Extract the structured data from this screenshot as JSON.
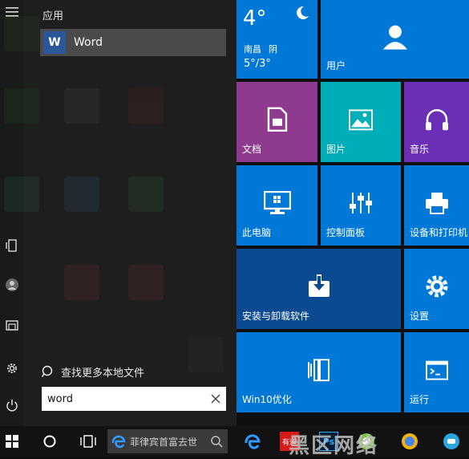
{
  "results": {
    "section_label": "应用",
    "top_result": {
      "icon_text": "W",
      "label": "Word"
    },
    "find_more": "查找更多本地文件",
    "search_value": "word"
  },
  "tiles": {
    "weather": {
      "temp": "4°",
      "city": "南昌",
      "condition": "阴",
      "range": "5°/3°"
    },
    "user": "用户",
    "documents": "文档",
    "pictures": "图片",
    "music": "音乐",
    "this_pc": "此电脑",
    "control_panel": "控制面板",
    "devices_printers": "设备和打印机",
    "install_uninstall": "安装与卸载软件",
    "settings": "设置",
    "win10_optimize": "Win10优化",
    "run": "运行"
  },
  "taskbar": {
    "search_text": "菲律宾首富去世",
    "badge_label": "有道",
    "watermark": "黑区网络"
  },
  "colors": {
    "accent": "#0078d7",
    "word": "#2b579a"
  }
}
